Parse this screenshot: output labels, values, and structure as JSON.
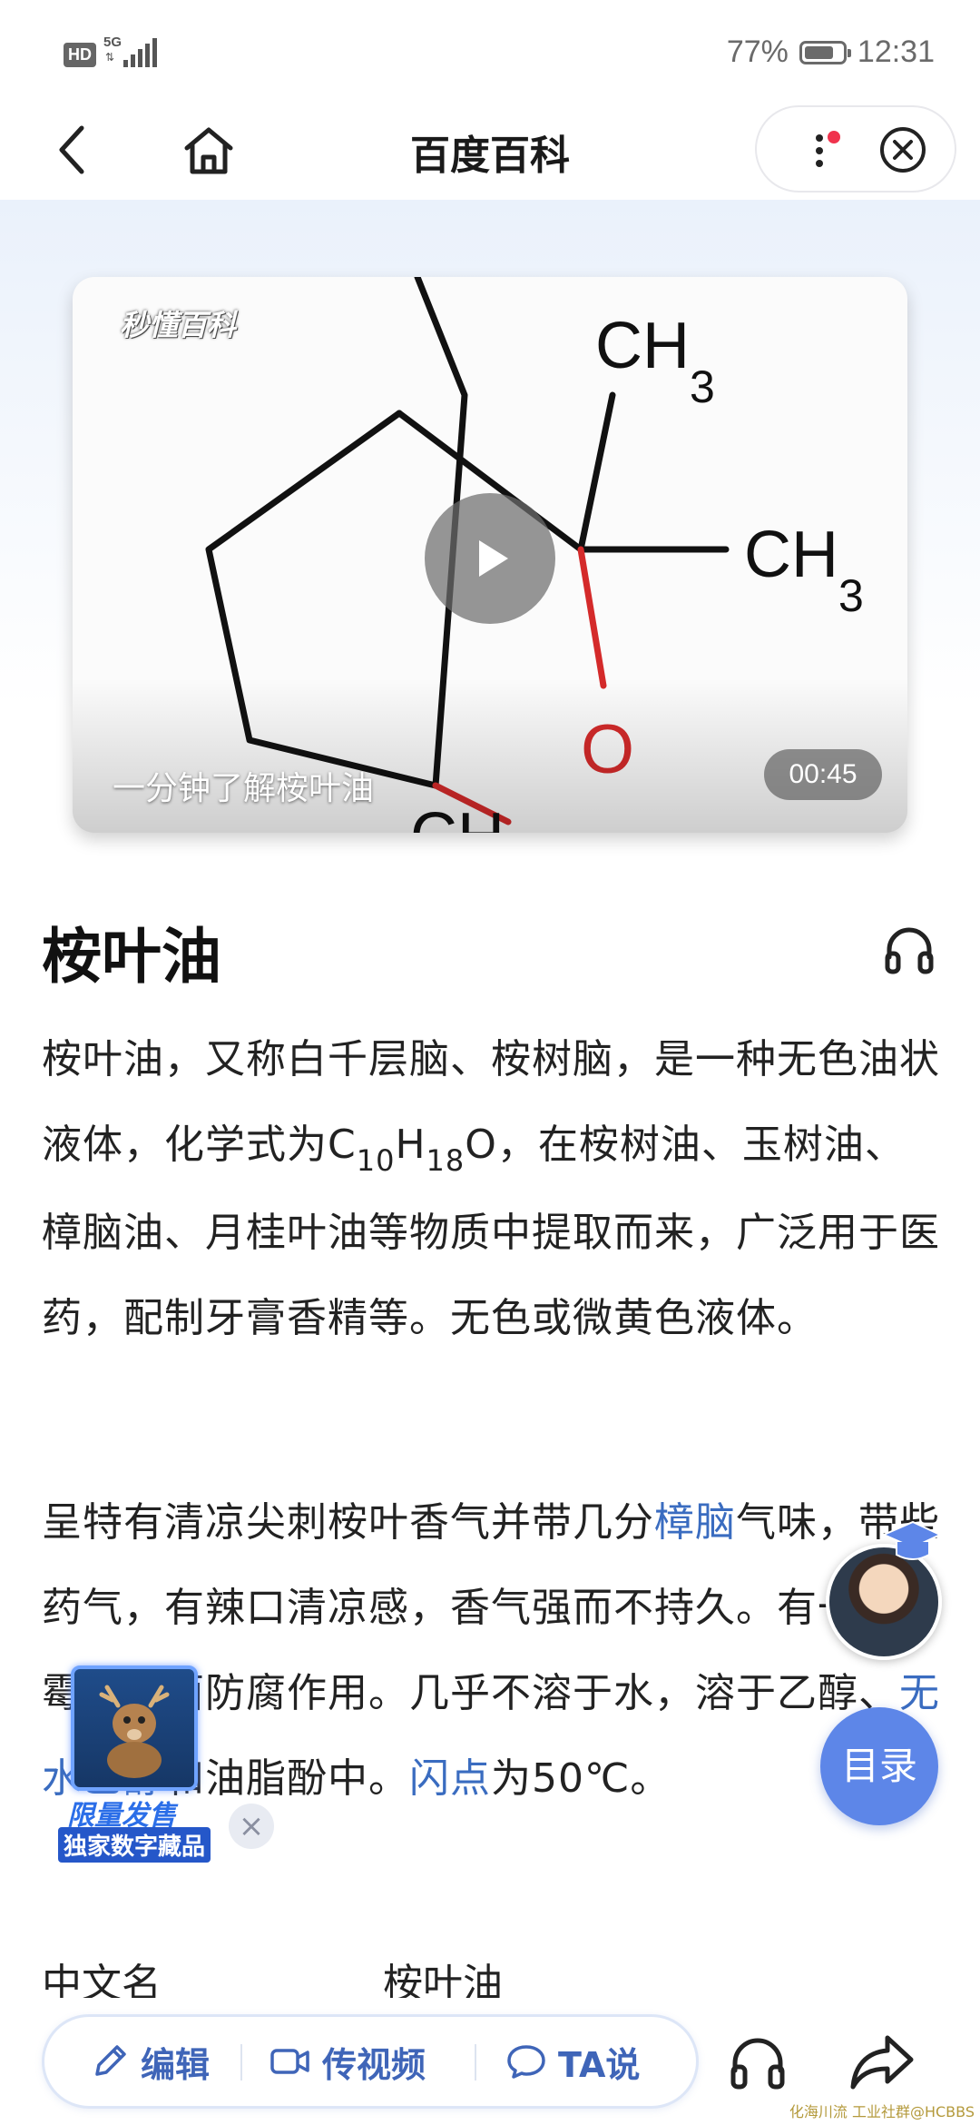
{
  "status_bar": {
    "network": "HD",
    "signal_label": "5G",
    "battery_percent": "77%",
    "battery_level": 0.77,
    "time": "12:31"
  },
  "nav": {
    "title": "百度百科",
    "back_icon": "chevron-left-icon",
    "home_icon": "home-icon",
    "more_icon": "more-vertical-icon",
    "close_icon": "close-circle-icon",
    "notification_color": "#f0334d"
  },
  "video": {
    "watermark": "秒懂百科",
    "caption": "一分钟了解桉叶油",
    "duration": "00:45",
    "molecule_labels": {
      "ch3_top": "CH",
      "ch3_top_sub": "3",
      "ch3_right": "CH",
      "ch3_right_sub": "3",
      "oxygen": "O",
      "ch_bottom": "CH"
    }
  },
  "entry": {
    "title": "桉叶油",
    "para1": {
      "a": "桉叶油，又称白千层脑、桉树脑，是一种无色油状液体，化学式为C",
      "sub1": "10",
      "b": "H",
      "sub2": "18",
      "c": "O，在桉树油、玉树油、樟脑油、月桂叶油等物质中提取而来，广泛用于医药，配制牙膏香精等。无色或微黄色液体。"
    },
    "para2": {
      "a": "呈特有清凉尖刺桉叶香气并带几分",
      "link1": "樟脑",
      "b": "气味，带些药气，有辣口清凉感，香气强而不持久。有一定防霉及杀菌防腐作用。几乎不溶于水，溶于乙醇、",
      "link2": "无水乙醇",
      "c": "和油脂酚中。",
      "link3": "闪点",
      "d": "为50℃。"
    },
    "facts": [
      {
        "label": "中文名",
        "value": "桉叶油"
      }
    ]
  },
  "floating": {
    "toc_label": "目录",
    "promo_line1": "限量发售",
    "promo_line2": "独家数字藏品",
    "promo_close": "×",
    "accent": "#5d86e8"
  },
  "bottom_bar": {
    "edit_label": "编辑",
    "video_label": "传视频",
    "ta_label": "TA说",
    "footer_mark": "化海川流 工业社群@HCBBS",
    "link_color": "#3a6cc0"
  }
}
